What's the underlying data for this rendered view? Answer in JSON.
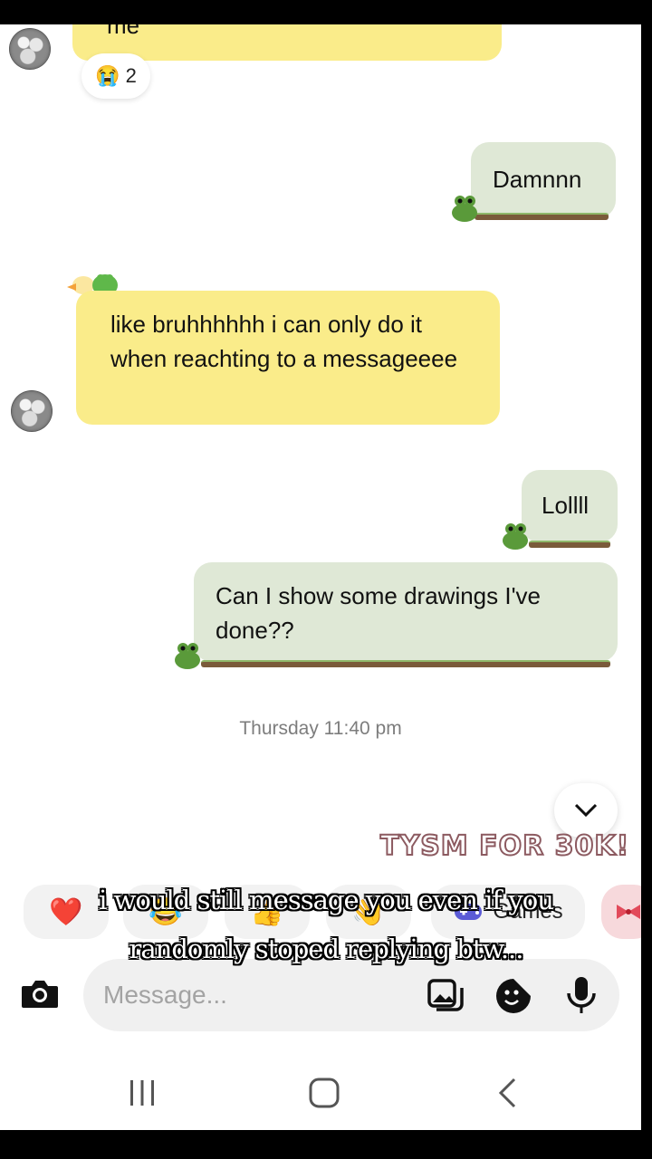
{
  "messages": {
    "partial_top": "me",
    "reaction": {
      "emoji": "😭",
      "count": "2"
    },
    "damn": "Damnnn",
    "like_bruh": "like bruhhhhhh i can only do it when reachting to a messageeee",
    "lol": "Lollll",
    "drawings": "Can I show some drawings I've done??"
  },
  "timestamp": "Thursday 11:40 pm",
  "sticker_text": "TYSM FOR 30K!",
  "quick_actions": {
    "heart": "❤️",
    "laugh": "😂",
    "thumbs": "👍",
    "wave": "👋",
    "games_label": "Games"
  },
  "composer": {
    "placeholder": "Message..."
  },
  "caption": "i would still message you even if you randomly stoped replying btw...",
  "colors": {
    "yellow_bubble": "#faec8a",
    "green_bubble": "#dfe8d6",
    "background": "#ffffff"
  }
}
